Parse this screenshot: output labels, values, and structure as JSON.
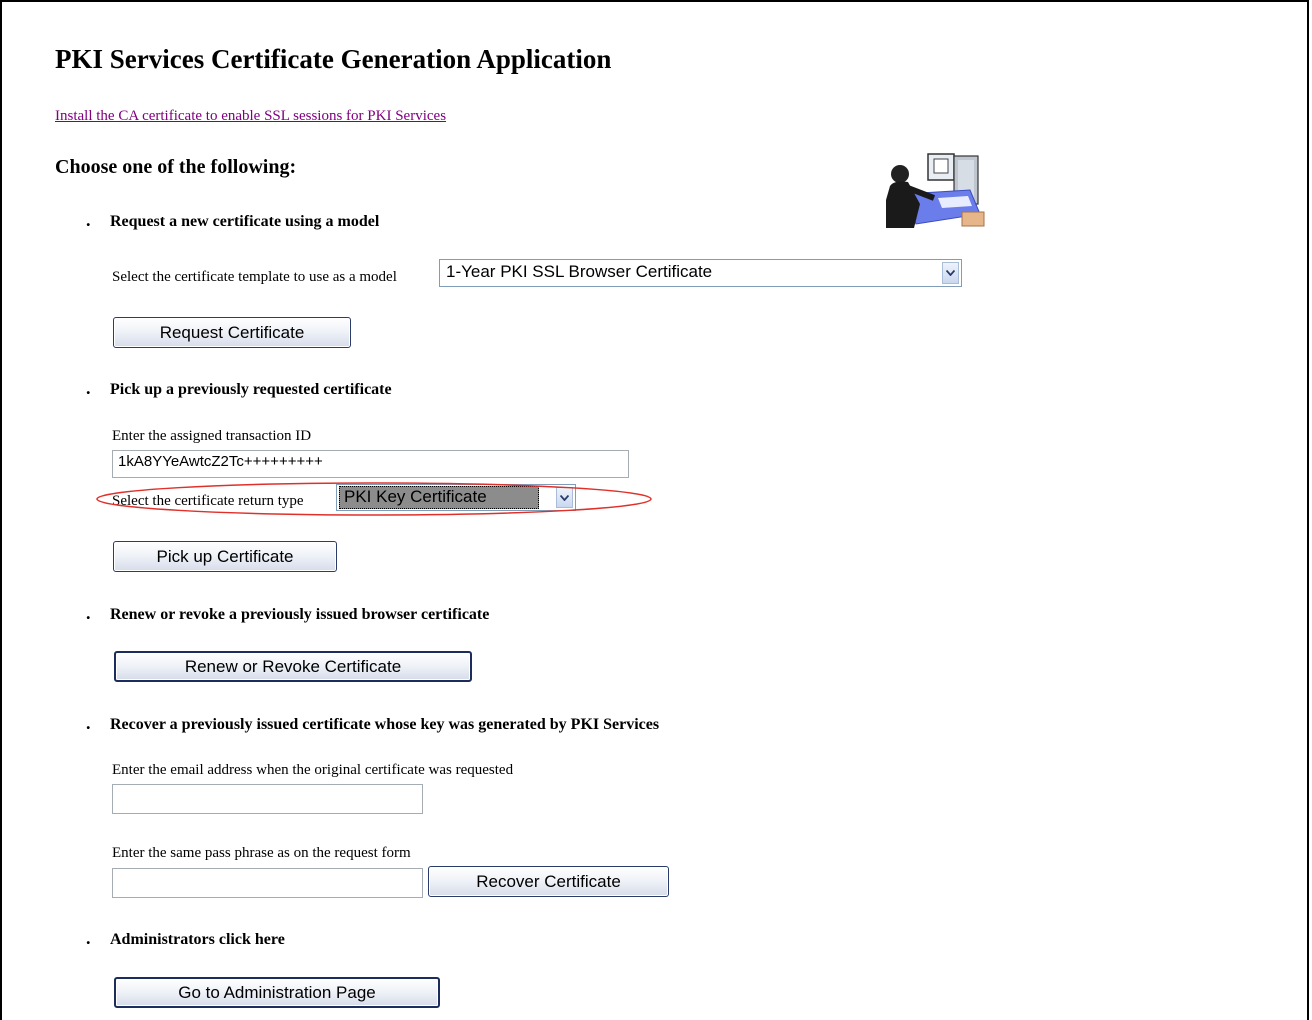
{
  "page": {
    "title": "PKI Services Certificate Generation Application",
    "ca_link": "Install the CA certificate to enable SSL sessions for PKI Services",
    "choose_heading": "Choose one of the following:"
  },
  "request_section": {
    "heading": "Request a new certificate using a model",
    "template_label": "Select the certificate template to use as a model",
    "template_value": "1-Year PKI SSL Browser Certificate",
    "button": "Request Certificate"
  },
  "pickup_section": {
    "heading": "Pick up a previously requested certificate",
    "txid_label": "Enter the assigned transaction ID",
    "txid_value": "1kA8YYeAwtcZ2Tc+++++++++",
    "return_type_label": "Select the certificate return type",
    "return_type_value": "PKI Key Certificate",
    "button": "Pick up Certificate"
  },
  "renew_section": {
    "heading": "Renew or revoke a previously issued browser certificate",
    "button": "Renew or Revoke Certificate"
  },
  "recover_section": {
    "heading": "Recover a previously issued certificate whose key was generated by PKI Services",
    "email_label": "Enter the email address when the original certificate was requested",
    "email_value": "",
    "passphrase_label": "Enter the same pass phrase as on the request form",
    "passphrase_value": "",
    "button": "Recover Certificate"
  },
  "admin_section": {
    "heading": "Administrators click here",
    "button": "Go to Administration Page"
  },
  "bullet_char": ".",
  "colors": {
    "link": "#800080",
    "highlight_ellipse": "#e0302a",
    "selected_option_bg": "#8c8c8c"
  }
}
